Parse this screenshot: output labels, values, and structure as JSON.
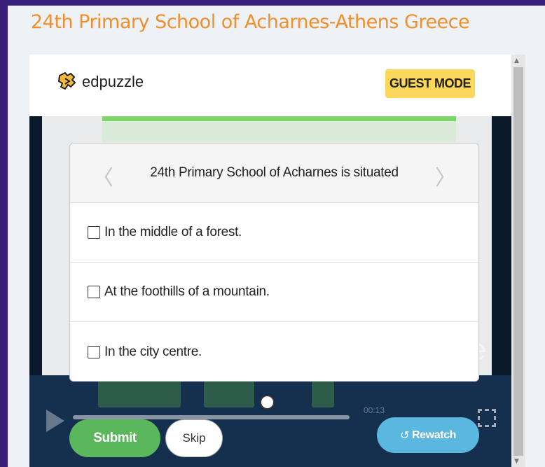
{
  "page": {
    "title": "24th Primary School of Acharnes-Athens Greece"
  },
  "header": {
    "logo_text": "edpuzzle",
    "guest_mode_label": "GUEST MODE"
  },
  "question": {
    "text": "24th Primary School of Acharnes is situated",
    "prev_arrow": "〈",
    "next_arrow": "〉",
    "options": [
      {
        "label": "In the middle of a forest.",
        "checked": false
      },
      {
        "label": "At the foothills of a mountain.",
        "checked": false
      },
      {
        "label": "In the city centre.",
        "checked": false
      }
    ]
  },
  "video": {
    "time": "00:13",
    "ghost_letter": "e"
  },
  "buttons": {
    "submit_label": "Submit",
    "skip_label": "Skip",
    "rewatch_label": "Rewatch",
    "rewatch_icon": "↺"
  },
  "scroll": {
    "up": "▲",
    "down": "▼"
  },
  "colors": {
    "background": "#3a1f7a",
    "title": "#f0902a",
    "guest_badge": "#fbd75b",
    "submit": "#5bb75b",
    "rewatch": "#5ab7e0",
    "progress": "#7ed66b"
  }
}
